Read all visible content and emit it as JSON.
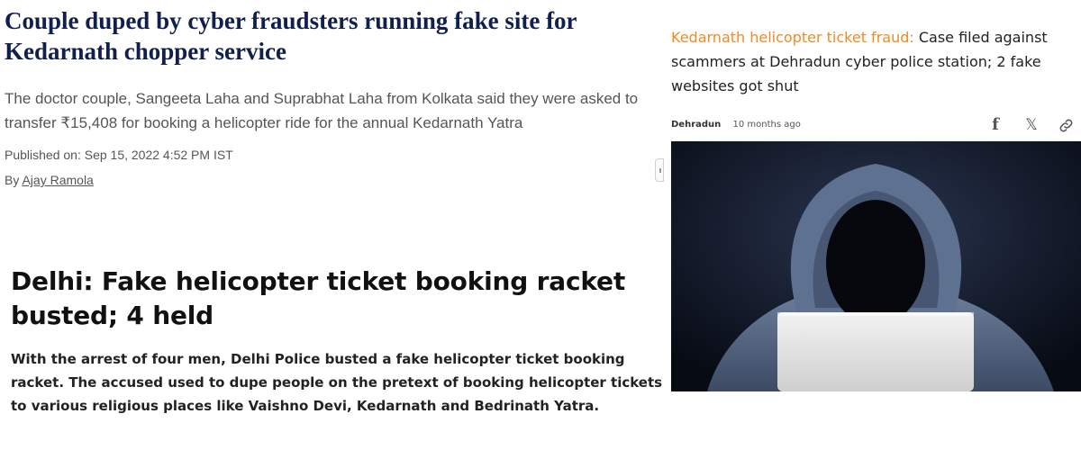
{
  "article1": {
    "title": "Couple duped by cyber fraudsters running fake site for Kedarnath chopper service",
    "subtitle": "The doctor couple, Sangeeta Laha and Suprabhat Laha from Kolkata said they were asked to transfer ₹15,408 for booking a helicopter ride for the annual Kedarnath Yatra",
    "published": "Published on: Sep 15, 2022 4:52 PM IST",
    "by_prefix": "By",
    "author": "Ajay Ramola"
  },
  "article2": {
    "title": "Delhi: Fake helicopter ticket booking racket busted; 4 held",
    "body": "With the arrest of four men, Delhi Police busted a fake helicopter ticket booking racket. The accused used to dupe people on the pretext of booking helicopter tickets to various religious places like Vaishno Devi, Kedarnath and Bedrinath Yatra."
  },
  "article3": {
    "kicker": "Kedarnath helicopter ticket fraud:",
    "headline": "Case filed against scammers at Dehradun cyber police station; 2 fake websites got shut",
    "location": "Dehradun",
    "time": "10 months ago",
    "share_icons": [
      "facebook-icon",
      "x-icon",
      "link-icon"
    ],
    "kicker_color": "#f08a24"
  }
}
